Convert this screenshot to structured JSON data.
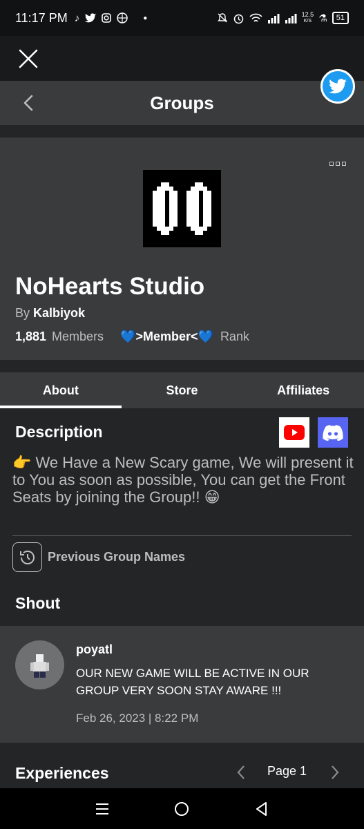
{
  "status_bar": {
    "time": "11:17 PM",
    "data_speed": "12.5",
    "data_unit": "K/S",
    "battery": "51",
    "left_icons": [
      "tiktok-icon",
      "twitter-icon",
      "instagram-icon",
      "vpn-icon",
      "dot-icon"
    ],
    "right_icons": [
      "mute-icon",
      "alarm-icon",
      "wifi-icon",
      "signal-icon",
      "signal-icon",
      "flask-icon"
    ]
  },
  "header": {
    "title": "Groups"
  },
  "group": {
    "name": "NoHearts Studio",
    "by_prefix": "By",
    "owner": "Kalbiyok",
    "member_count": "1,881",
    "members_label": "Members",
    "rank": "💙>Member<💙",
    "rank_label": "Rank"
  },
  "tabs": [
    {
      "label": "About",
      "active": true
    },
    {
      "label": "Store",
      "active": false
    },
    {
      "label": "Affiliates",
      "active": false
    }
  ],
  "description": {
    "title": "Description",
    "text": "👉 We Have a New Scary game, We will present it to You as soon as possible, You can get the Front Seats by joining the Group!! 😁",
    "previous_names_label": "Previous Group Names"
  },
  "shout": {
    "title": "Shout",
    "user": "poyatl",
    "text": "OUR NEW GAME WILL BE ACTIVE IN OUR GROUP VERY SOON STAY AWARE !!!",
    "date": "Feb 26, 2023 | 8:22 PM"
  },
  "experiences": {
    "title": "Experiences",
    "page_label": "Page 1"
  },
  "colors": {
    "background": "#232527",
    "card": "#393b3d",
    "twitter": "#1d9bf0",
    "discord": "#5865f2",
    "youtube": "#ff0000"
  }
}
